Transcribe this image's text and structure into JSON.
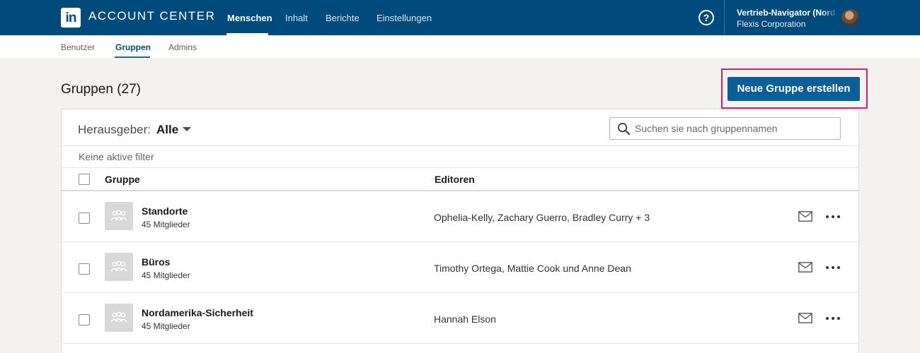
{
  "app": {
    "logo_text": "in",
    "title": "ACCOUNT CENTER"
  },
  "nav": {
    "items": [
      {
        "label": "Menschen",
        "active": true
      },
      {
        "label": "Inhalt"
      },
      {
        "label": "Berichte"
      },
      {
        "label": "Einstellungen"
      }
    ]
  },
  "account": {
    "name": "Vertrieb-Navigator (Nordamerika)",
    "organization": "Flexis Corporation"
  },
  "subnav": {
    "tabs": [
      {
        "label": "Benutzer"
      },
      {
        "label": "Gruppen",
        "active": true
      },
      {
        "label": "Admins"
      }
    ]
  },
  "page": {
    "title": "Gruppen (27)",
    "create_button": "Neue Gruppe erstellen"
  },
  "filter": {
    "label": "Herausgeber:",
    "value": "Alle",
    "search_placeholder": "Suchen sie nach gruppennamen",
    "no_filters": "Keine aktive filter"
  },
  "table": {
    "columns": [
      "Gruppe",
      "Editoren"
    ],
    "rows": [
      {
        "name": "Standorte",
        "members": "45 Mitglieder",
        "editors": "Ophelia-Kelly, Zachary Guerro, Bradley Curry + 3"
      },
      {
        "name": "Büros",
        "members": "45 Mitglieder",
        "editors": "Timothy Ortega, Mattie Cook und Anne Dean"
      },
      {
        "name": "Nordamerika-Sicherheit",
        "members": "45 Mitglieder",
        "editors": "Hannah Elson"
      }
    ]
  },
  "colors": {
    "topbar": "#004b7c",
    "primary_button": "#0a5e99",
    "highlight": "#e0176b"
  }
}
